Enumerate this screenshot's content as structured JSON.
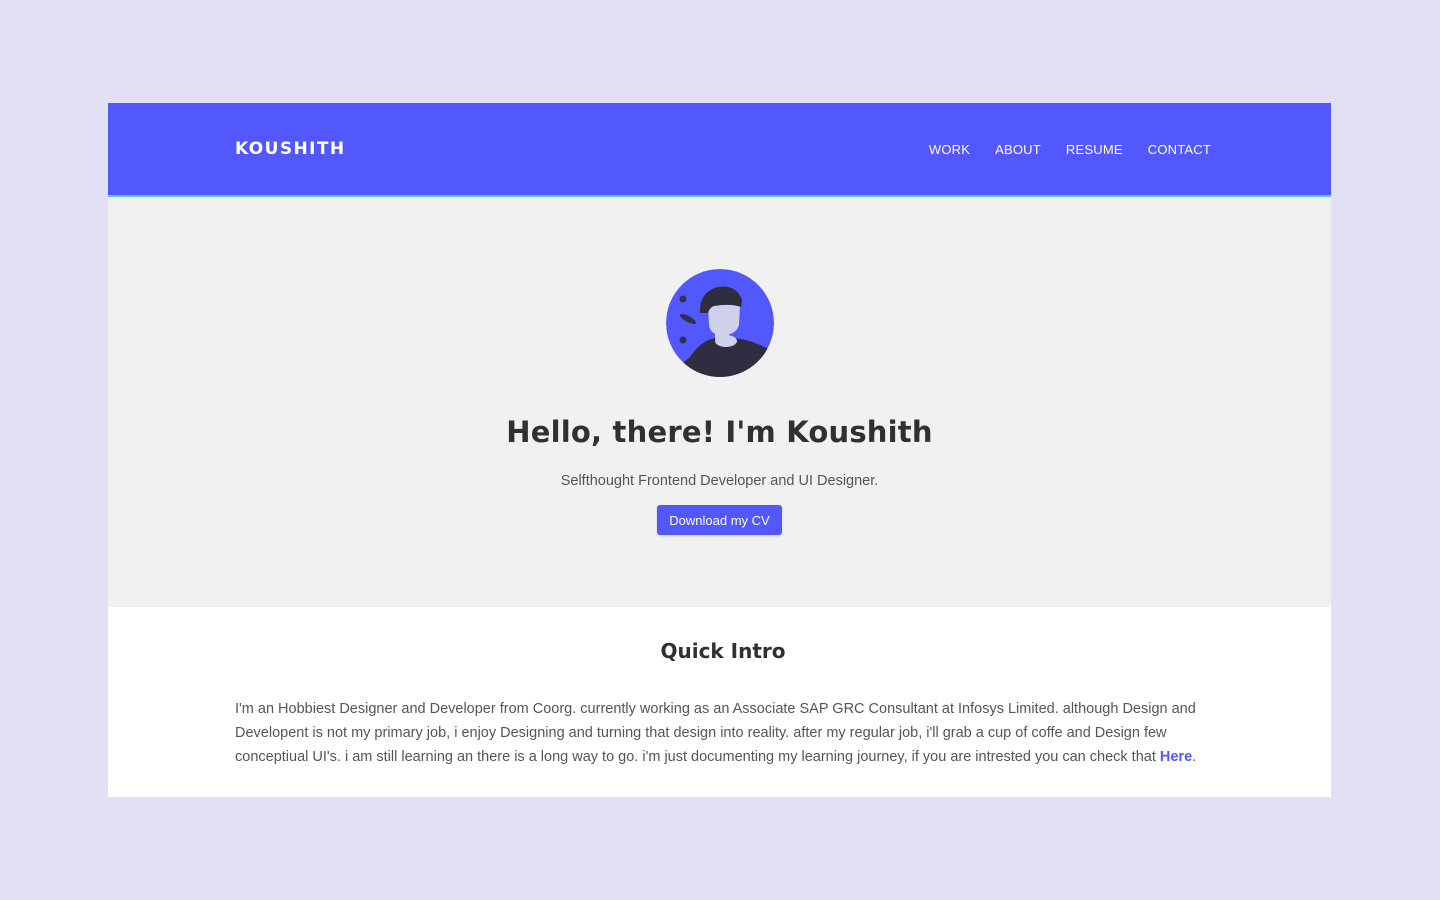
{
  "navbar": {
    "brand": "KOUSHITH",
    "links": [
      "WORK",
      "ABOUT",
      "RESUME",
      "CONTACT"
    ]
  },
  "hero": {
    "title": "Hello, there! I'm Koushith",
    "subtitle": "Selfthought Frontend Developer and UI Designer.",
    "button_label": "Download my CV"
  },
  "intro": {
    "title": "Quick Intro",
    "text": "I'm an Hobbiest Designer and Developer from Coorg. currently working as an Associate SAP GRC Consultant at Infosys Limited. although Design and Developent is not my primary job, i enjoy Designing and turning that design into reality. after my regular job, i'll grab a cup of coffe and Design few conceptiual UI's. i am still learning an there is a long way to go. i'm just documenting my learning journey, if you are intrested you can check that ",
    "link_label": "Here",
    "text_end": "."
  },
  "icons": {
    "avatar": "person-avatar-illustration"
  },
  "colors": {
    "accent": "#5257fe",
    "page_background": "#e1e1f3",
    "hero_background": "#f1f1f1",
    "navbar_border": "#59c8dc",
    "heading_text": "#303033",
    "body_text": "#555555"
  }
}
